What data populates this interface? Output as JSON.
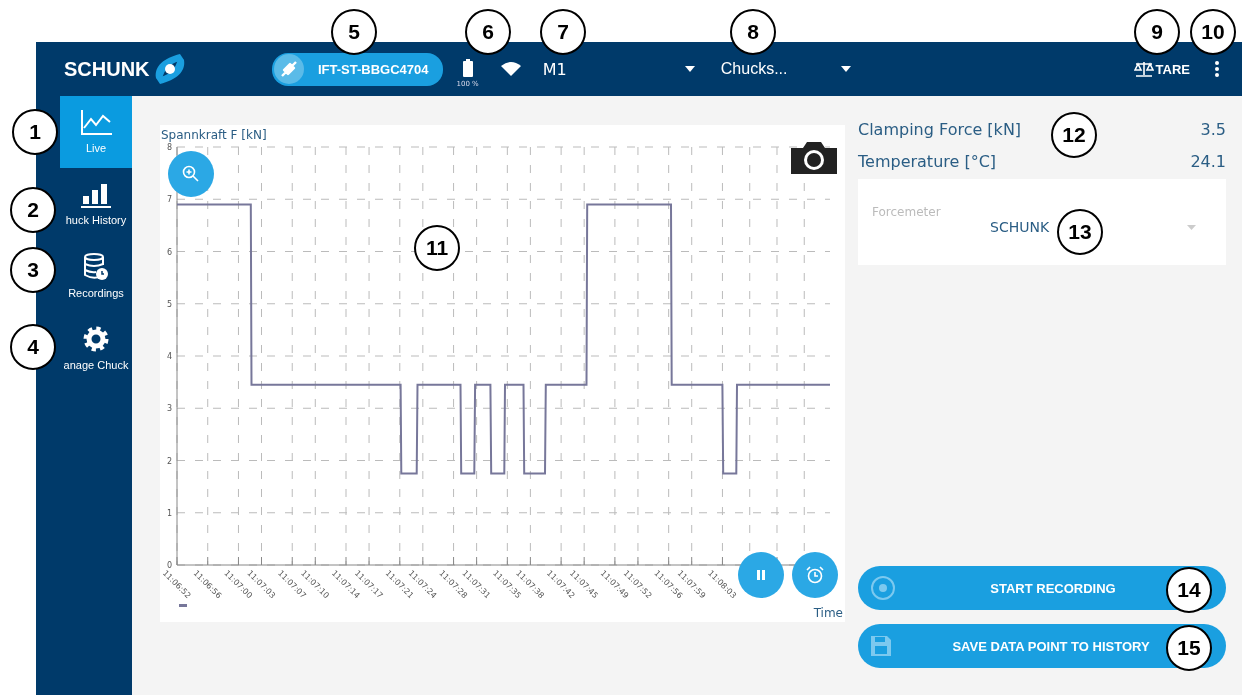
{
  "header": {
    "logo": "SCHUNK",
    "device": "IFT-ST-BBGC4704",
    "battery_reading": "100 %",
    "machine_select": "M1",
    "chuck_select": "Chucks...",
    "tare_button": "TARE"
  },
  "sidebar": {
    "items": [
      {
        "label": "Live",
        "selected": true
      },
      {
        "label": "huck History",
        "selected": false
      },
      {
        "label": "Recordings",
        "selected": false
      },
      {
        "label": "anage Chuck",
        "selected": false
      }
    ]
  },
  "chart": {
    "chart_data": {
      "type": "line",
      "grid": true,
      "ylabel": "Spannkraft F [kN]",
      "xlabel": "Time",
      "xlim": [
        40012,
        40097
      ],
      "ylim": [
        0,
        8
      ],
      "yticks": [
        0,
        1,
        2,
        3,
        4,
        5,
        6,
        7,
        8
      ],
      "xticks": [
        {
          "value": 40012,
          "label": "11:06:52"
        },
        {
          "value": 40016,
          "label": "11:06:56"
        },
        {
          "value": 40020,
          "label": "11:07:00"
        },
        {
          "value": 40023,
          "label": "11:07:03"
        },
        {
          "value": 40027,
          "label": "11:07:07"
        },
        {
          "value": 40030,
          "label": "11:07:10"
        },
        {
          "value": 40034,
          "label": "11:07:14"
        },
        {
          "value": 40037,
          "label": "11:07:17"
        },
        {
          "value": 40041,
          "label": "11:07:21"
        },
        {
          "value": 40044,
          "label": "11:07:24"
        },
        {
          "value": 40048,
          "label": "11:07:28"
        },
        {
          "value": 40051,
          "label": "11:07:31"
        },
        {
          "value": 40055,
          "label": "11:07:35"
        },
        {
          "value": 40058,
          "label": "11:07:38"
        },
        {
          "value": 40062,
          "label": "11:07:42"
        },
        {
          "value": 40065,
          "label": "11:07:45"
        },
        {
          "value": 40069,
          "label": "11:07:49"
        },
        {
          "value": 40072,
          "label": "11:07:52"
        },
        {
          "value": 40076,
          "label": "11:07:56"
        },
        {
          "value": 40079,
          "label": "11:07:59"
        },
        {
          "value": 40083,
          "label": "11:08:03"
        }
      ],
      "x": [
        40012,
        40021.6,
        40021.7,
        40041.1,
        40041.2,
        40043.2,
        40043.3,
        40048.9,
        40049.0,
        40050.7,
        40050.8,
        40052.8,
        40052.9,
        40054.6,
        40054.7,
        40057.1,
        40057.2,
        40059.9,
        40060.0,
        40065.3,
        40065.4,
        40076.3,
        40076.4,
        40083.0,
        40083.1,
        40084.8,
        40084.9,
        40097
      ],
      "series": [
        {
          "color": "#77779a",
          "values": [
            6.9,
            6.9,
            3.45,
            3.45,
            1.75,
            1.75,
            3.45,
            3.45,
            1.75,
            1.75,
            3.45,
            3.45,
            1.75,
            1.75,
            3.45,
            3.45,
            1.75,
            1.75,
            3.45,
            3.45,
            6.9,
            6.9,
            3.45,
            3.45,
            1.75,
            1.75,
            3.45,
            3.45
          ]
        }
      ]
    }
  },
  "readings": [
    {
      "label": "Clamping Force [kN]",
      "value": "3.5"
    },
    {
      "label": "Temperature [°C]",
      "value": "24.1"
    }
  ],
  "forcemeter": {
    "label": "Forcemeter",
    "value": "SCHUNK"
  },
  "buttons": [
    {
      "kind": "record",
      "label": "START RECORDING"
    },
    {
      "kind": "save",
      "label": "SAVE DATA POINT TO HISTORY"
    }
  ],
  "callouts": [
    "1",
    "2",
    "3",
    "4",
    "5",
    "6",
    "7",
    "8",
    "9",
    "10",
    "11",
    "12",
    "13",
    "14",
    "15"
  ]
}
